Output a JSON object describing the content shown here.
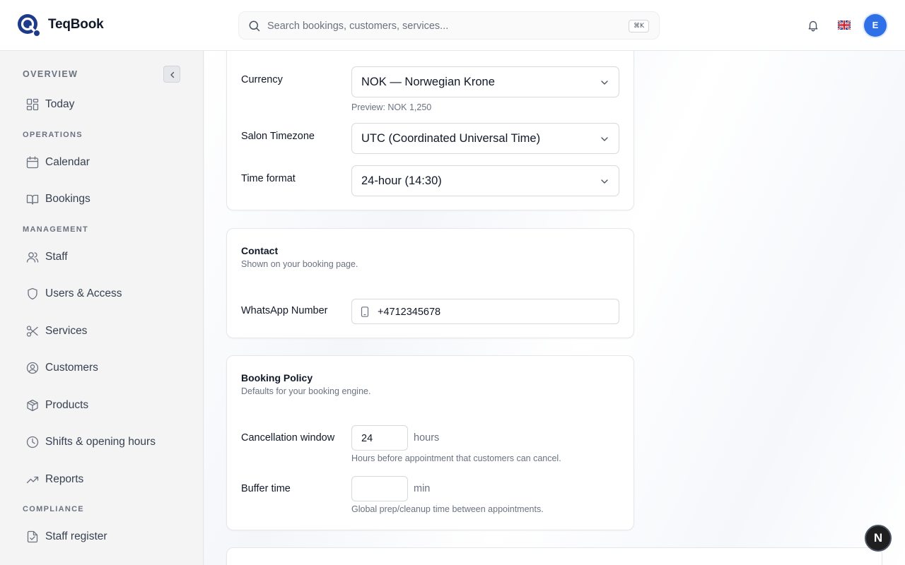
{
  "header": {
    "brand": "TeqBook",
    "search_placeholder": "Search bookings, customers, services...",
    "search_shortcut": "⌘K",
    "avatar_initial": "E"
  },
  "sidebar": {
    "sections": [
      {
        "label": "OVERVIEW",
        "items": [
          {
            "label": "Today",
            "icon": "dashboard-icon"
          }
        ]
      },
      {
        "label": "OPERATIONS",
        "items": [
          {
            "label": "Calendar",
            "icon": "calendar-icon"
          },
          {
            "label": "Bookings",
            "icon": "book-icon"
          }
        ]
      },
      {
        "label": "MANAGEMENT",
        "items": [
          {
            "label": "Staff",
            "icon": "users-icon"
          },
          {
            "label": "Users & Access",
            "icon": "shield-icon"
          },
          {
            "label": "Services",
            "icon": "scissors-icon"
          },
          {
            "label": "Customers",
            "icon": "user-circle-icon"
          },
          {
            "label": "Products",
            "icon": "package-icon"
          },
          {
            "label": "Shifts & opening hours",
            "icon": "clock-icon"
          },
          {
            "label": "Reports",
            "icon": "trending-up-icon"
          }
        ]
      },
      {
        "label": "COMPLIANCE",
        "items": [
          {
            "label": "Staff register",
            "icon": "file-check-icon"
          }
        ]
      }
    ]
  },
  "regional": {
    "currency_label": "Currency",
    "currency_value": "NOK — Norwegian Krone",
    "currency_preview": "Preview: NOK 1,250",
    "timezone_label": "Salon Timezone",
    "timezone_value": "UTC (Coordinated Universal Time)",
    "timeformat_label": "Time format",
    "timeformat_value": "24-hour (14:30)"
  },
  "contact": {
    "title": "Contact",
    "subtitle": "Shown on your booking page.",
    "whatsapp_label": "WhatsApp Number",
    "whatsapp_value": "+4712345678"
  },
  "booking_policy": {
    "title": "Booking Policy",
    "subtitle": "Defaults for your booking engine.",
    "cancellation_label": "Cancellation window",
    "cancellation_value": "24",
    "cancellation_unit": "hours",
    "cancellation_hint": "Hours before appointment that customers can cancel.",
    "buffer_label": "Buffer time",
    "buffer_value": "",
    "buffer_unit": "min",
    "buffer_hint": "Global prep/cleanup time between appointments."
  },
  "dev_badge": "N",
  "colors": {
    "accent": "#2f6fe8",
    "brand_logo": "#1e3a8a"
  }
}
